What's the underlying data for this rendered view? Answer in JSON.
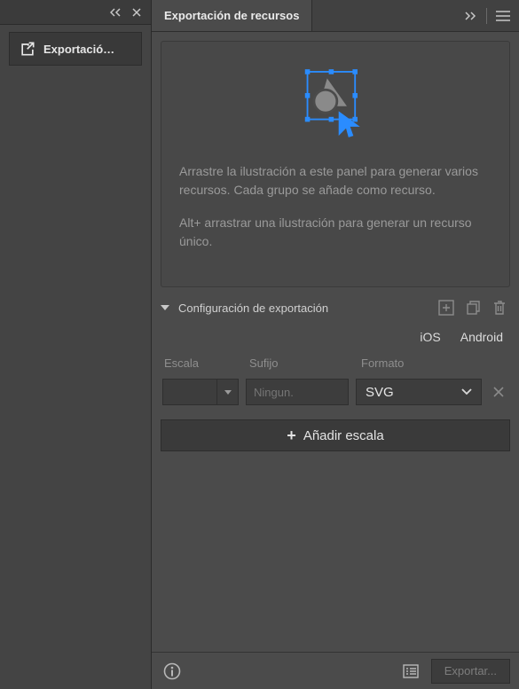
{
  "leftTab": {
    "label": "Exportació…"
  },
  "panel": {
    "title": "Exportación de recursos",
    "drop": {
      "p1": "Arrastre la ilustración a este panel para generar varios recursos. Cada grupo se añade como recurso.",
      "p2": "Alt+ arrastrar una ilustración para generar un recurso único."
    },
    "configLabel": "Configuración de exportación",
    "platforms": {
      "ios": "iOS",
      "android": "Android"
    },
    "columns": {
      "escala": "Escala",
      "sufijo": "Sufijo",
      "formato": "Formato"
    },
    "row": {
      "sufijoPlaceholder": "Ningun.",
      "formato": "SVG"
    },
    "addScale": "Añadir escala",
    "exportBtn": "Exportar..."
  }
}
